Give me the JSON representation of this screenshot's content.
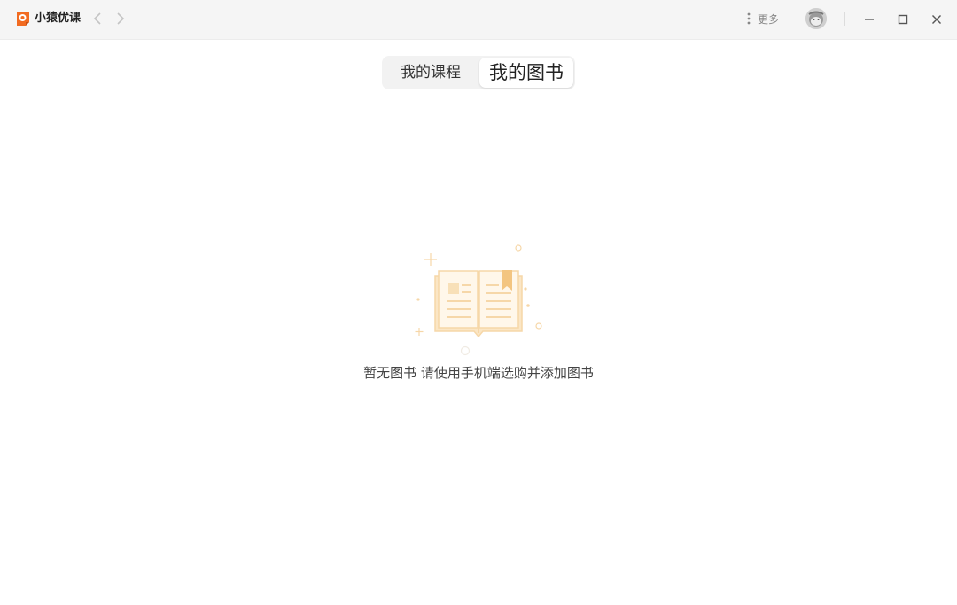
{
  "titlebar": {
    "app_name": "小猿优课",
    "more_label": "更多"
  },
  "tabs": [
    {
      "label": "我的课程",
      "active": false
    },
    {
      "label": "我的图书",
      "active": true
    }
  ],
  "empty_state": {
    "message": "暂无图书 请使用手机端选购并添加图书"
  },
  "colors": {
    "brand_orange": "#f26b21",
    "illustration_orange": "#f6d7a8",
    "titlebar_bg": "#f5f5f5"
  },
  "icons": {
    "logo": "xiaoyuan-logo",
    "back": "chevron-left-icon",
    "forward": "chevron-right-icon",
    "more": "vertical-dots-icon",
    "minimize": "minimize-icon",
    "maximize": "maximize-icon",
    "close": "close-icon",
    "empty": "open-book-illustration"
  }
}
